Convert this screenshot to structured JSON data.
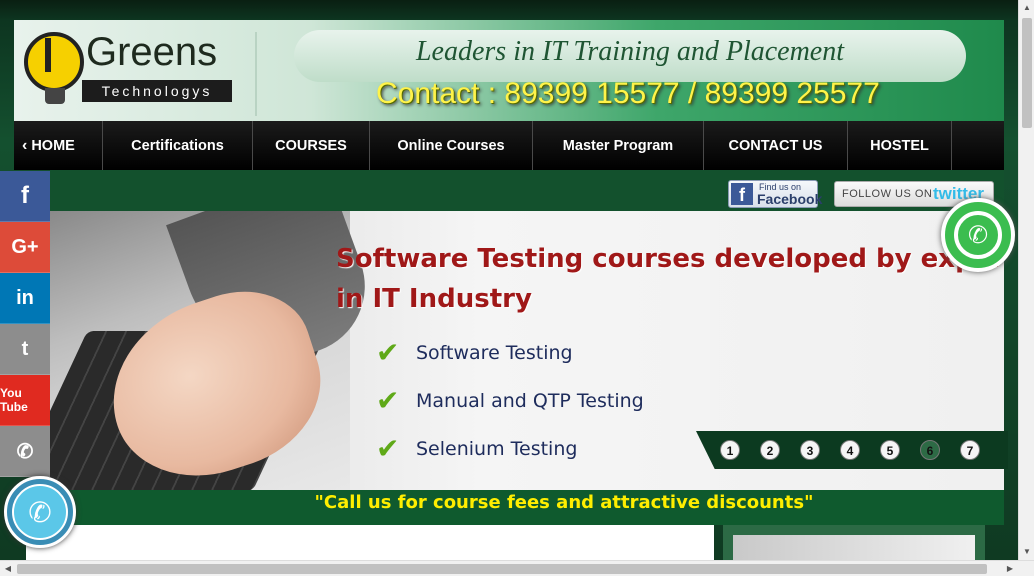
{
  "header": {
    "logo_text": "Greens",
    "logo_subtext": "Technologys",
    "tagline": "Leaders in IT Training and Placement",
    "contact": "Contact : 89399 15577 / 89399 25577"
  },
  "nav": {
    "items": [
      {
        "label": "HOME"
      },
      {
        "label": "Certifications"
      },
      {
        "label": "COURSES"
      },
      {
        "label": "Online Courses"
      },
      {
        "label": "Master Program"
      },
      {
        "label": "CONTACT US"
      },
      {
        "label": "HOSTEL"
      }
    ]
  },
  "social_links": {
    "facebook_small": "Find us on",
    "facebook_big": "Facebook",
    "twitter_label": "FOLLOW US ON",
    "twitter_brand": "twitter"
  },
  "banner": {
    "headline": "Software Testing courses developed by experts in IT Industry",
    "bullets": [
      "Software Testing",
      "Manual and QTP Testing",
      "Selenium Testing"
    ],
    "slides": [
      "1",
      "2",
      "3",
      "4",
      "5",
      "6",
      "7"
    ],
    "active_slide": "6"
  },
  "callbar": {
    "text": "\"Call us for course fees and attractive discounts\""
  },
  "side_social": {
    "facebook": "f",
    "googleplus": "G+",
    "linkedin": "in",
    "twitter": "t",
    "youtube": "You Tube",
    "phone": "✆"
  },
  "colors": {
    "accent_green": "#14502f",
    "headline_red": "#a01818",
    "callbar_yellow": "#ffee00",
    "contact_yellow": "#fff34a"
  },
  "icons": {
    "whatsapp": "whatsapp-icon",
    "call": "phone-icon"
  }
}
